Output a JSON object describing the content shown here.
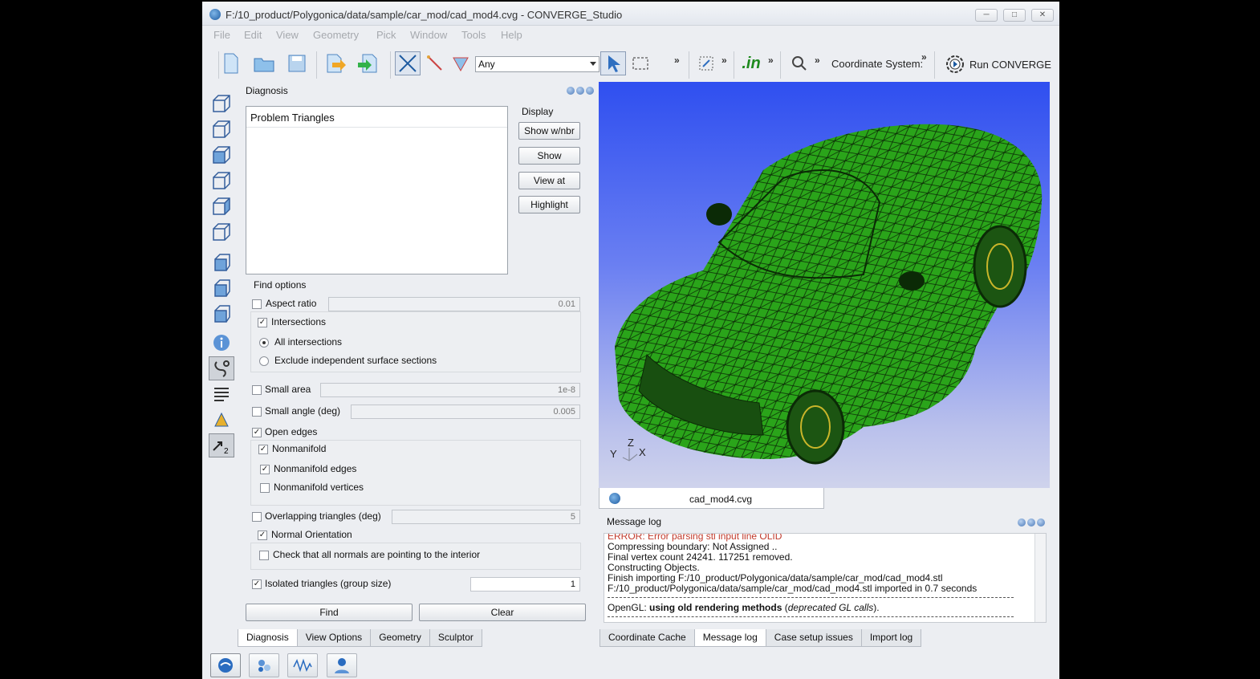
{
  "window": {
    "title": "F:/10_product/Polygonica/data/sample/car_mod/cad_mod4.cvg - CONVERGE_Studio"
  },
  "menu": [
    "File",
    "Edit",
    "View",
    "Geometry",
    "Pick",
    "Window",
    "Tools",
    "Help"
  ],
  "toolbar": {
    "select_value": "Any",
    "coordinate_system": "Coordinate System:",
    "run_label": "Run CONVERGE",
    "in_label": ".in",
    "more": "»"
  },
  "diagnosis": {
    "title": "Diagnosis",
    "list_header": "Problem Triangles",
    "display_label": "Display",
    "buttons": [
      "Show w/nbr",
      "Show",
      "View at",
      "Highlight"
    ],
    "find_options_label": "Find options",
    "aspect_ratio": {
      "label": "Aspect ratio",
      "value": "0.01",
      "checked": false
    },
    "intersections": {
      "label": "Intersections",
      "checked": true
    },
    "all_intersections": "All intersections",
    "exclude_sections": "Exclude independent surface sections",
    "small_area": {
      "label": "Small area",
      "value": "1e-8",
      "checked": false
    },
    "small_angle": {
      "label": "Small angle (deg)",
      "value": "0.005",
      "checked": false
    },
    "open_edges": {
      "label": "Open edges",
      "checked": true
    },
    "nonmanifold": {
      "label": "Nonmanifold",
      "checked": true
    },
    "nonmanifold_edges": {
      "label": "Nonmanifold edges",
      "checked": true
    },
    "nonmanifold_vertices": {
      "label": "Nonmanifold vertices",
      "checked": false
    },
    "overlapping": {
      "label": "Overlapping triangles (deg)",
      "value": "5",
      "checked": false
    },
    "normal_orientation": {
      "label": "Normal Orientation",
      "checked": true
    },
    "normals_interior": {
      "label": "Check that all normals are pointing to the interior",
      "checked": false
    },
    "isolated": {
      "label": "Isolated triangles (group size)",
      "value": "1",
      "checked": true
    },
    "find_button": "Find",
    "clear_button": "Clear"
  },
  "left_tabs": [
    "Diagnosis",
    "View Options",
    "Geometry",
    "Sculptor"
  ],
  "viewport": {
    "tab_label": "cad_mod4.cvg",
    "axis_z": "Z",
    "axis_y": "Y",
    "axis_x": "X",
    "mesh_color": "#22a016",
    "bg_top": "#2f4ff0"
  },
  "message_log": {
    "title": "Message log",
    "lines": [
      "ERROR: Error parsing stl input line OLID",
      "Compressing boundary: Not Assigned ..",
      "Final vertex count 24241. 117251 removed.",
      "Constructing Objects.",
      "Finish importing F:/10_product/Polygonica/data/sample/car_mod/cad_mod4.stl",
      "F:/10_product/Polygonica/data/sample/car_mod/cad_mod4.stl imported in 0.7 seconds"
    ],
    "opengl_prefix": "OpenGL: ",
    "opengl_bold": "using old rendering methods",
    "opengl_italic": "deprecated GL calls"
  },
  "right_tabs": [
    "Coordinate Cache",
    "Message log",
    "Case setup issues",
    "Import log"
  ]
}
